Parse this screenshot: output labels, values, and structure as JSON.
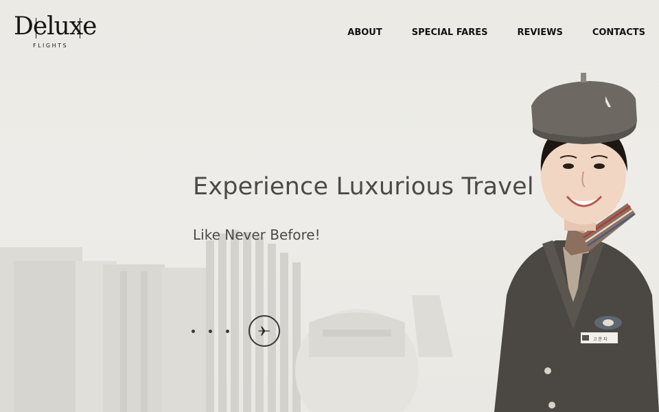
{
  "brand": {
    "logo_word": "Deluxe",
    "logo_sub": "FLIGHTS"
  },
  "nav": {
    "items": [
      {
        "label": "ABOUT"
      },
      {
        "label": "SPECIAL FARES"
      },
      {
        "label": "REVIEWS"
      },
      {
        "label": "CONTACTS"
      }
    ]
  },
  "hero": {
    "title": "Experience Luxurious Travel",
    "subtitle": "Like Never Before!"
  },
  "slider": {
    "dot_count": 3,
    "action_icon": "airplane-icon"
  },
  "colors": {
    "background": "#ecebe6",
    "text_dark": "#111111",
    "hero_text": "#4a4a46",
    "uniform": "#4b4742",
    "hat": "#6d6862"
  },
  "badge_text": "고 한 지"
}
